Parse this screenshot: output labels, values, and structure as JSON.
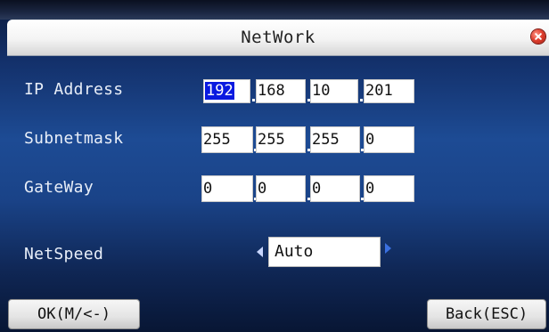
{
  "dialog": {
    "title": "NetWork",
    "close_icon": "close-icon"
  },
  "rows": {
    "ip": {
      "label": "IP Address",
      "octets": [
        "192",
        "168",
        "10",
        "201"
      ],
      "selected_octet": 0
    },
    "subnet": {
      "label": "Subnetmask",
      "octets": [
        "255",
        "255",
        "255",
        "0"
      ]
    },
    "gateway": {
      "label": "GateWay",
      "octets": [
        "0",
        "0",
        "0",
        "0"
      ]
    },
    "netspeed": {
      "label": "NetSpeed",
      "value": "Auto",
      "left_icon": "arrow-left-icon",
      "right_icon": "arrow-right-icon"
    }
  },
  "buttons": {
    "ok_label": "OK(M/<-)",
    "back_label": "Back(ESC)"
  },
  "colors": {
    "selection": "#0a1ae0",
    "close": "#e04030",
    "background_blue": "#1d4b94"
  }
}
